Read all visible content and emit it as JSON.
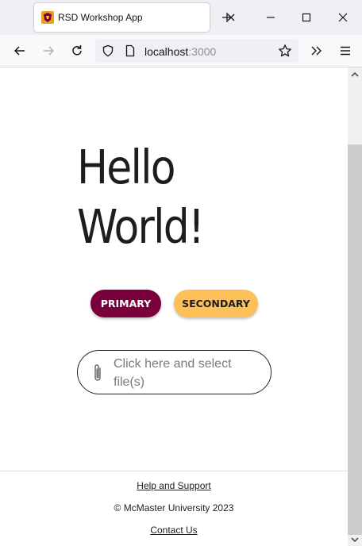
{
  "browser": {
    "tab_title": "RSD Workshop App",
    "url_host": "localhost",
    "url_port": ":3000"
  },
  "page": {
    "heading_line1": "Hello",
    "heading_line2": "World!",
    "primary_label": "PRIMARY",
    "secondary_label": "SECONDARY",
    "file_placeholder": "Click here and select file(s)"
  },
  "footer": {
    "help_link": "Help and Support",
    "copyright": "© McMaster University 2023",
    "contact_link": "Contact Us"
  },
  "colors": {
    "primary": "#7a003c",
    "secondary": "#fdbf57"
  },
  "icons": {
    "favicon": "mcmaster-crest-icon",
    "file": "paperclip-icon"
  }
}
